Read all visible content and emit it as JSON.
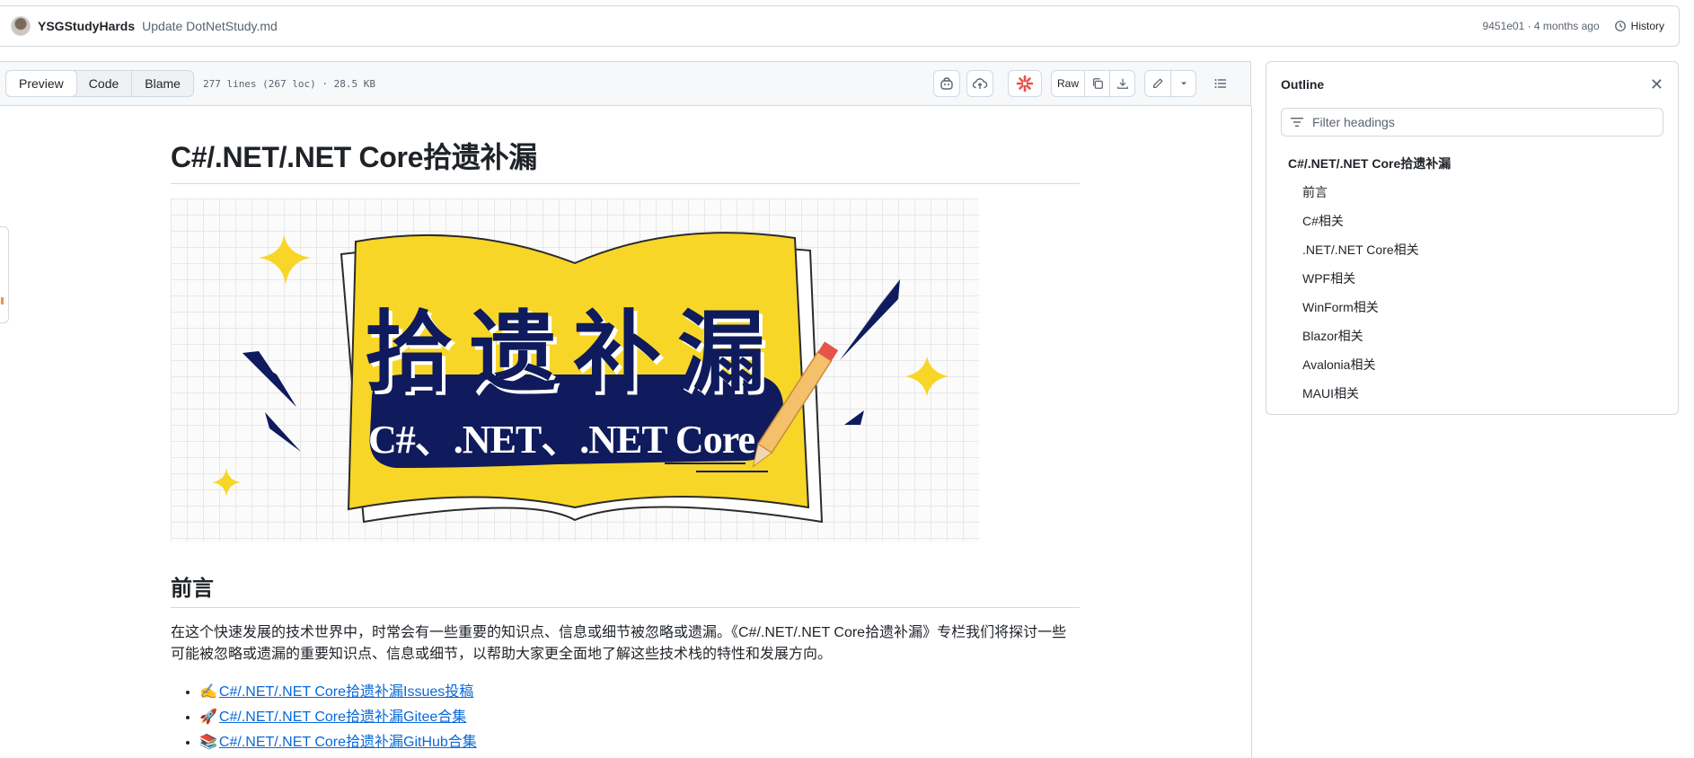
{
  "commit": {
    "author": "YSGStudyHards",
    "message": "Update DotNetStudy.md",
    "sha_time": "9451e01 · 4 months ago",
    "history_label": "History"
  },
  "toolbar": {
    "tabs": [
      "Preview",
      "Code",
      "Blame"
    ],
    "active_tab": "Preview",
    "file_info": "277 lines (267 loc) · 28.5 KB",
    "raw_label": "Raw"
  },
  "document": {
    "title": "C#/.NET/.NET Core拾遗补漏",
    "banner_title": "拾遗补漏",
    "banner_subtitle": "C#、.NET、.NET Core",
    "section_heading": "前言",
    "paragraph": "在这个快速发展的技术世界中，时常会有一些重要的知识点、信息或细节被忽略或遗漏。《C#/.NET/.NET Core拾遗补漏》专栏我们将探讨一些可能被忽略或遗漏的重要知识点、信息或细节，以帮助大家更全面地了解这些技术栈的特性和发展方向。",
    "links": [
      {
        "emoji": "✍️",
        "text": "C#/.NET/.NET Core拾遗补漏Issues投稿"
      },
      {
        "emoji": "🚀",
        "text": "C#/.NET/.NET Core拾遗补漏Gitee合集"
      },
      {
        "emoji": "📚",
        "text": "C#/.NET/.NET Core拾遗补漏GitHub合集"
      }
    ]
  },
  "outline": {
    "title": "Outline",
    "filter_placeholder": "Filter headings",
    "items": [
      {
        "level": 1,
        "text": "C#/.NET/.NET Core拾遗补漏"
      },
      {
        "level": 2,
        "text": "前言"
      },
      {
        "level": 2,
        "text": "C#相关"
      },
      {
        "level": 2,
        "text": ".NET/.NET Core相关"
      },
      {
        "level": 2,
        "text": "WPF相关"
      },
      {
        "level": 2,
        "text": "WinForm相关"
      },
      {
        "level": 2,
        "text": "Blazor相关"
      },
      {
        "level": 2,
        "text": "Avalonia相关"
      },
      {
        "level": 2,
        "text": "MAUI相关"
      }
    ]
  },
  "colors": {
    "link": "#0969da",
    "banner_yellow": "#f7d628",
    "banner_navy": "#0f1b5c",
    "border": "#d1d9e0"
  }
}
